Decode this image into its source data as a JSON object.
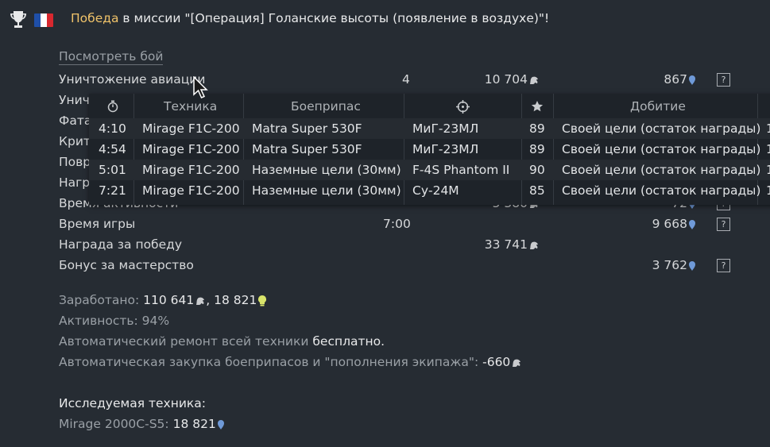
{
  "header": {
    "victory_word": "Победа",
    "mission_text": " в миссии \"[Операция] Голанские высоты (появление в воздухе)\"!",
    "flag_colors": [
      "#1f4fa8",
      "#ffffff",
      "#d8282f"
    ],
    "trophy_icon": "trophy-icon"
  },
  "watch_battle_link": "Посмотреть бой",
  "rows": [
    {
      "label": "Уничтожение авиации",
      "count": "4",
      "silver": "10 704",
      "rp": "867",
      "help": "?"
    },
    {
      "label": "Унич",
      "count": "",
      "silver": "",
      "rp": "",
      "help": ""
    },
    {
      "label": "Фата",
      "count": "",
      "silver": "",
      "rp": "",
      "help": ""
    },
    {
      "label": "Крит",
      "count": "",
      "silver": "",
      "rp": "",
      "help": ""
    },
    {
      "label": "Повр",
      "count": "",
      "silver": "",
      "rp": "",
      "help": ""
    },
    {
      "label": "Нагр",
      "count": "",
      "silver": "",
      "rp": "",
      "help": ""
    },
    {
      "label": "Время активности",
      "count": "",
      "silver": "5 380",
      "rp": "72",
      "help": "?"
    },
    {
      "label": "Время игры",
      "count": "7:00",
      "silver": "",
      "rp": "9 668",
      "help": "?"
    },
    {
      "label": "Награда за победу",
      "count": "",
      "silver": "33 741",
      "rp": "",
      "help": ""
    },
    {
      "label": "Бонус за мастерство",
      "count": "",
      "silver": "",
      "rp": "3 762",
      "help": "?"
    }
  ],
  "tooltip": {
    "headers": {
      "time_icon": "stopwatch-icon",
      "vehicle": "Техника",
      "ammo": "Боеприпас",
      "target_icon": "crosshair-icon",
      "score_icon": "star-icon",
      "finish": "Добитие"
    },
    "rows": [
      {
        "time": "4:10",
        "vehicle": "Mirage F1C-200",
        "ammo": "Matra Super 530F",
        "target": "МиГ-23МЛ",
        "score": "89",
        "finish": "Своей цели (остаток награды)",
        "extra": "1"
      },
      {
        "time": "4:54",
        "vehicle": "Mirage F1C-200",
        "ammo": "Matra Super 530F",
        "target": "МиГ-23МЛ",
        "score": "89",
        "finish": "Своей цели (остаток награды)",
        "extra": "1"
      },
      {
        "time": "5:01",
        "vehicle": "Mirage F1C-200",
        "ammo": "Наземные цели (30мм)",
        "target": "F-4S Phantom II",
        "score": "90",
        "finish": "Своей цели (остаток награды)",
        "extra": "1"
      },
      {
        "time": "7:21",
        "vehicle": "Mirage F1C-200",
        "ammo": "Наземные цели (30мм)",
        "target": "Су-24М",
        "score": "85",
        "finish": "Своей цели (остаток награды)",
        "extra": "1"
      }
    ]
  },
  "summary": {
    "earned_label": "Заработано: ",
    "earned_silver": "110 641",
    "earned_sep": ", ",
    "earned_rp": "18 821",
    "activity": "Активность: 94%",
    "repair_label": "Автоматический ремонт всей техники ",
    "repair_value": "бесплатно.",
    "restock_label": "Автоматическая закупка боеприпасов и \"пополнения экипажа\": ",
    "restock_value": "-660"
  },
  "research": {
    "title": "Исследуемая техника:",
    "vehicle": "Mirage 2000C-S5",
    "sep": ": ",
    "rp": "18 821"
  },
  "colors": {
    "background": "#262c33",
    "accent_gold": "#f0c36a",
    "rp_blue": "#6f9ad8",
    "convertible_rp": "#d8e46a"
  }
}
